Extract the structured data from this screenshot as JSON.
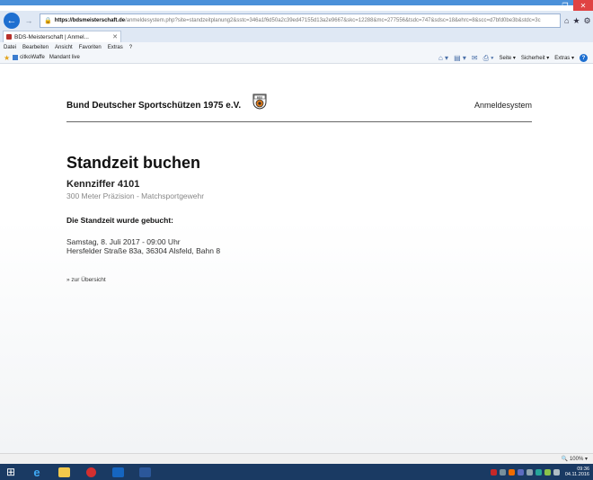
{
  "browser": {
    "url_host": "https://bdsmeisterschaft.de",
    "url_rest": "/anmeldesystem.php?site=standzeitplanung2&sstc=346a1f6d50a2c39ed47155d13a2e9667&skc=12288&mc=277556&tsdc=747&sdsc=18&ehrc=8&scc=d7bfd0be3b&stdc=3c",
    "tab_title": "BDS-Meisterschaft | Anmel...",
    "menu": [
      "Datei",
      "Bearbeiten",
      "Ansicht",
      "Favoriten",
      "Extras",
      "?"
    ],
    "favorites": [
      "citkoWaffe",
      "Mandant live"
    ],
    "commands": [
      "Seite",
      "Sicherheit",
      "Extras"
    ],
    "zoom": "100%",
    "clock_time": "09:36",
    "clock_date": "04.11.2016"
  },
  "site": {
    "org_name": "Bund Deutscher Sportschützen 1975 e.V.",
    "logo_text": "BDS",
    "system_name": "Anmeldesystem"
  },
  "content": {
    "title": "Standzeit buchen",
    "code_label": "Kennziffer 4101",
    "discipline": "300 Meter Präzision - Matchsportgewehr",
    "confirmation": "Die Standzeit wurde gebucht:",
    "datetime": "Samstag, 8. Juli 2017 - 09:00 Uhr",
    "location": "Hersfelder Straße 83a, 36304 Alsfeld, Bahn 8",
    "back_link": "» zur Übersicht"
  },
  "colors": {
    "taskbar": "#1a3a63",
    "accent": "#1e6fd0",
    "close": "#e04343"
  }
}
